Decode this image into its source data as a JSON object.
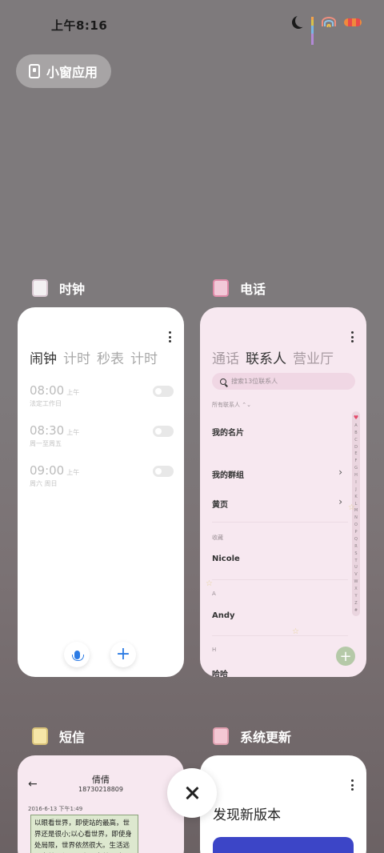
{
  "status_bar": {
    "time": "上午8:16"
  },
  "floating_window": {
    "label": "小窗应用"
  },
  "cards": {
    "clock": {
      "app_name": "时钟",
      "tabs": [
        "闹钟",
        "计时",
        "秒表",
        "计时"
      ],
      "alarms": [
        {
          "time": "08:00",
          "ampm": "上午",
          "repeat": "法定工作日"
        },
        {
          "time": "08:30",
          "ampm": "上午",
          "repeat": "周一至周五"
        },
        {
          "time": "09:00",
          "ampm": "上午",
          "repeat": "周六 周日"
        }
      ]
    },
    "phone": {
      "app_name": "电话",
      "tabs": [
        "通话",
        "联系人",
        "营业厅"
      ],
      "search_placeholder": "搜索13位联系人",
      "filter_label": "所有联系人",
      "my_card": "我的名片",
      "groups": "我的群组",
      "yellow_pages": "黄页",
      "favorites_header": "收藏",
      "favorite_contact": "Nicole",
      "section_a": "A",
      "contact_a": "Andy",
      "section_h": "H",
      "contact_h": "哈哈",
      "index_letters": [
        "A",
        "B",
        "C",
        "D",
        "E",
        "F",
        "G",
        "H",
        "I",
        "J",
        "K",
        "L",
        "M",
        "N",
        "O",
        "P",
        "Q",
        "R",
        "S",
        "T",
        "U",
        "V",
        "W",
        "X",
        "Y",
        "Z",
        "#"
      ]
    },
    "sms": {
      "app_name": "短信",
      "contact_name": "倩倩",
      "contact_number": "18730218809",
      "date": "2016-6-13 下午1:49",
      "message": "以眼看世界，即使站的最高，世界还是很小;以心看世界，即使身处局限，世界依然很大。生活远不完美，但是只有不完美，才更觉美"
    },
    "update": {
      "app_name": "系统更新",
      "title": "发现新版本"
    }
  }
}
